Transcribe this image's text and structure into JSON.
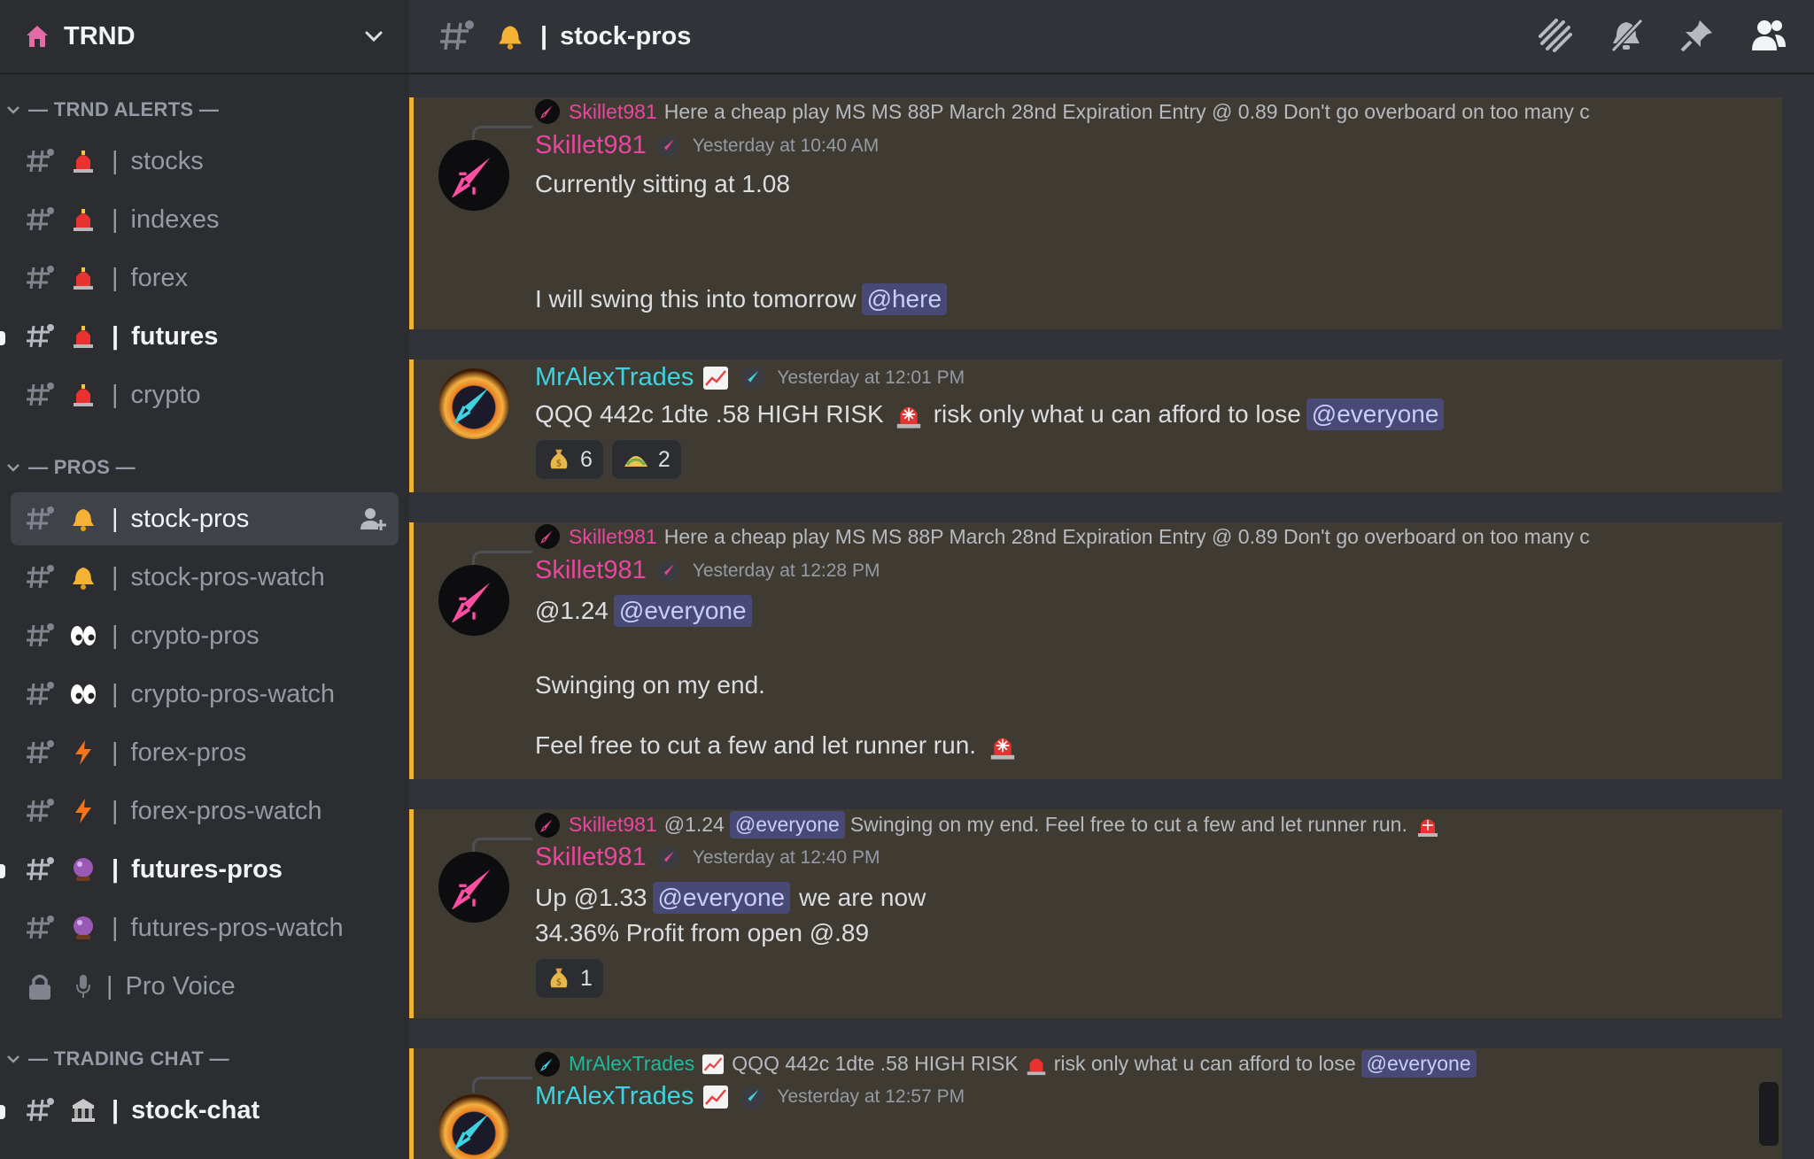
{
  "server": {
    "name": "TRND",
    "icon": "house-icon"
  },
  "categories": [
    {
      "label": "— TRND ALERTS —",
      "channels": [
        {
          "name": "stocks",
          "emoji": "siren-icon",
          "unread": false
        },
        {
          "name": "indexes",
          "emoji": "siren-icon",
          "unread": false
        },
        {
          "name": "forex",
          "emoji": "siren-icon",
          "unread": false
        },
        {
          "name": "futures",
          "emoji": "siren-icon",
          "unread": true
        },
        {
          "name": "crypto",
          "emoji": "siren-icon",
          "unread": false
        }
      ]
    },
    {
      "label": "— PROS —",
      "channels": [
        {
          "name": "stock-pros",
          "emoji": "bell-icon",
          "selected": true
        },
        {
          "name": "stock-pros-watch",
          "emoji": "bell-icon"
        },
        {
          "name": "crypto-pros",
          "emoji": "eyes-icon"
        },
        {
          "name": "crypto-pros-watch",
          "emoji": "eyes-icon"
        },
        {
          "name": "forex-pros",
          "emoji": "lightning-icon"
        },
        {
          "name": "forex-pros-watch",
          "emoji": "lightning-icon"
        },
        {
          "name": "futures-pros",
          "emoji": "crystal-ball-icon",
          "unread": true
        },
        {
          "name": "futures-pros-watch",
          "emoji": "crystal-ball-icon"
        },
        {
          "name": "Pro Voice",
          "emoji": "microphone-icon",
          "locked": true
        }
      ]
    },
    {
      "label": "— TRADING CHAT —",
      "channels": [
        {
          "name": "stock-chat",
          "emoji": "bank-icon",
          "unread": true
        }
      ]
    }
  ],
  "topbar": {
    "channel_name": "stock-pros",
    "separator": "|"
  },
  "sep": "|",
  "messages": [
    {
      "reply_author": "Skillet981",
      "reply_text": "Here a cheap play MS MS 88P March 28nd Expiration Entry @ 0.89 Don't go overboard on too many c",
      "author": "Skillet981",
      "timestamp": "Yesterday at 10:40 AM",
      "line1": "Currently sitting at 1.08",
      "line2": "I will swing this into tomorrow",
      "mention": "@here"
    },
    {
      "author": "MrAlexTrades",
      "timestamp": "Yesterday at 12:01 PM",
      "text_a": "QQQ 442c  1dte .58  HIGH RISK",
      "text_b": "risk only what u can afford to lose",
      "mention": "@everyone",
      "reactions": [
        {
          "emoji": "money-bag-icon",
          "count": "6"
        },
        {
          "emoji": "taco-icon",
          "count": "2"
        }
      ]
    },
    {
      "reply_author": "Skillet981",
      "reply_text": "Here a cheap play MS MS 88P March 28nd Expiration Entry @ 0.89 Don't go overboard on too many c",
      "author": "Skillet981",
      "timestamp": "Yesterday at 12:28 PM",
      "line1": "@1.24",
      "mention": "@everyone",
      "line2": "Swinging on my end.",
      "line3": "Feel free to cut a few and let runner run."
    },
    {
      "reply_author": "Skillet981",
      "reply_a": "@1.24",
      "reply_mention": "@everyone",
      "reply_b": "Swinging on my end. Feel free to cut a few and let runner run.",
      "author": "Skillet981",
      "timestamp": "Yesterday at 12:40 PM",
      "line1a": "Up @1.33",
      "mention": "@everyone",
      "line1b": "we are now",
      "line2": "34.36% Profit from open @.89",
      "reactions": [
        {
          "emoji": "money-bag-icon",
          "count": "1"
        }
      ]
    },
    {
      "reply_author": "MrAlexTrades",
      "reply_a": "QQQ 442c 1dte .58 HIGH RISK",
      "reply_b": "risk only what u can afford to lose",
      "reply_mention": "@everyone",
      "author": "MrAlexTrades",
      "timestamp": "Yesterday at 12:57 PM"
    }
  ],
  "colors": {
    "sidebar": "#2b2d31",
    "chat": "#313338",
    "highlight": "#3f3b32",
    "highlight_border": "#f0b232",
    "skillet": "#eb459f",
    "alex": "#1abc9c"
  }
}
